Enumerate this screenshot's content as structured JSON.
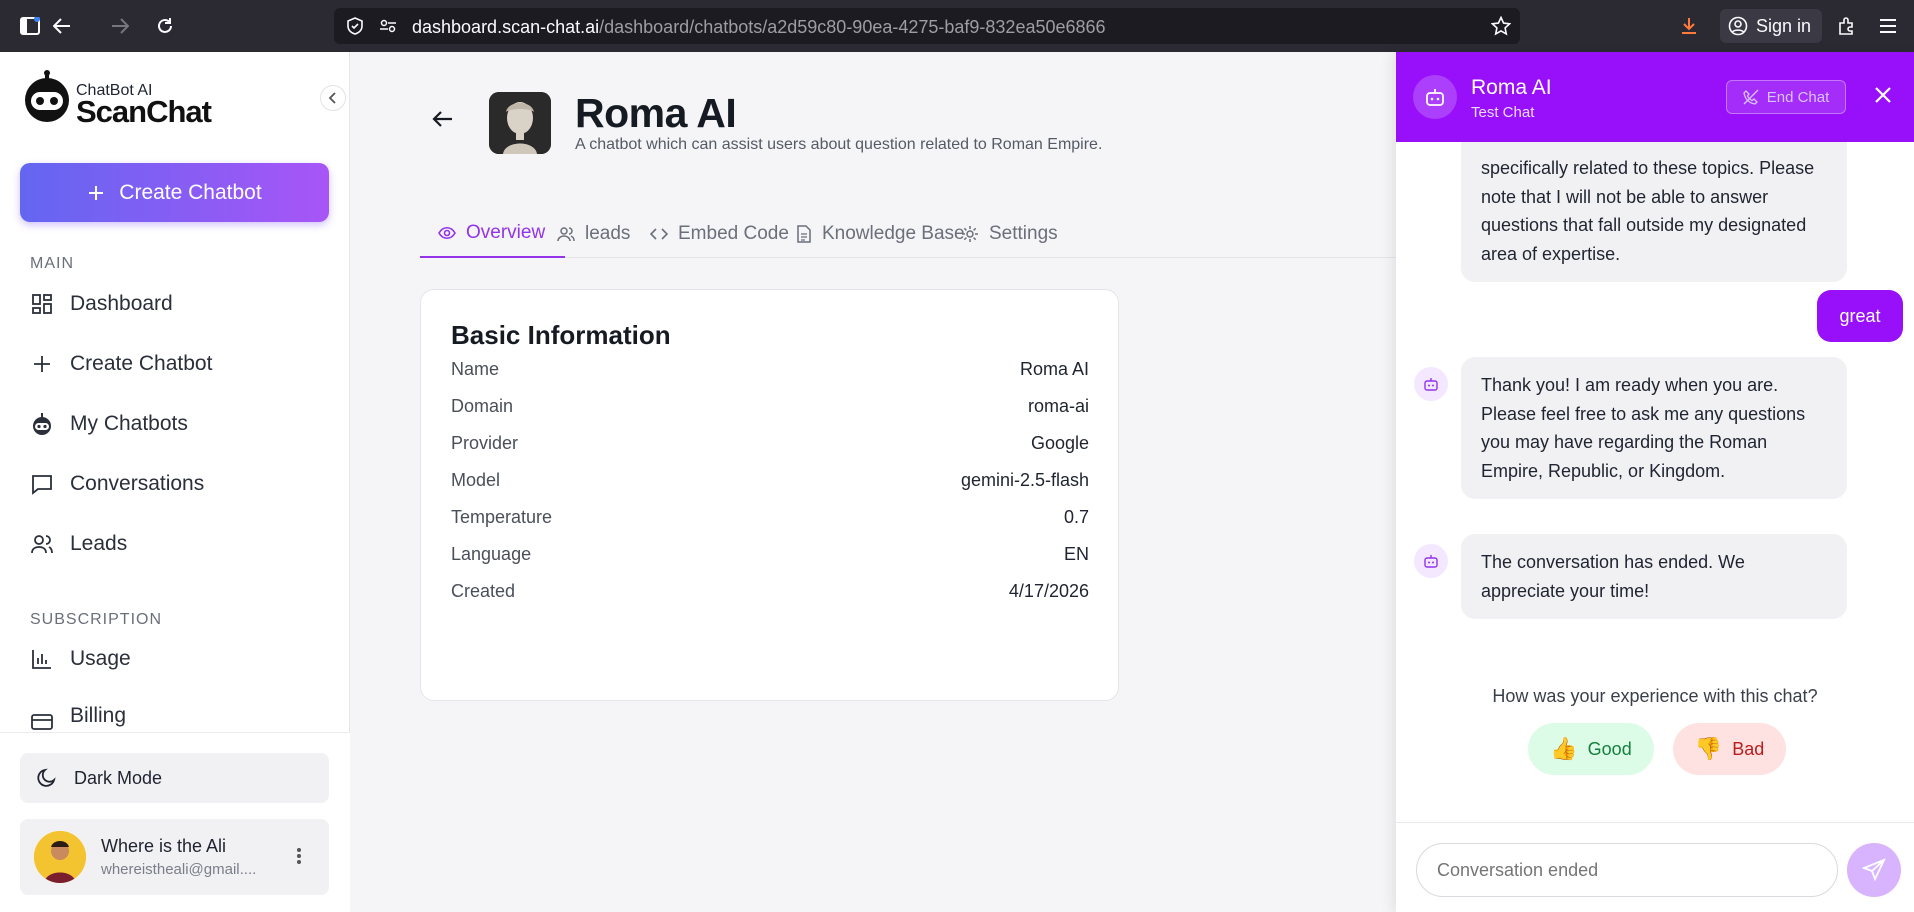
{
  "browser": {
    "url_domain": "dashboard.scan-chat.ai",
    "url_path": "/dashboard/chatbots/a2d59c80-90ea-4275-baf9-832ea50e6866",
    "sign_in": "Sign in"
  },
  "sidebar": {
    "logo_small": "ChatBot AI",
    "logo_big": "ScanChat",
    "create_button": "Create Chatbot",
    "section_main": "MAIN",
    "items": [
      {
        "label": "Dashboard",
        "icon": "dashboard-icon"
      },
      {
        "label": "Create Chatbot",
        "icon": "plus-icon"
      },
      {
        "label": "My Chatbots",
        "icon": "robot-icon"
      },
      {
        "label": "Conversations",
        "icon": "message-icon"
      },
      {
        "label": "Leads",
        "icon": "users-icon"
      }
    ],
    "section_subscription": "SUBSCRIPTION",
    "sub_items": [
      {
        "label": "Usage",
        "icon": "bar-chart-icon"
      },
      {
        "label": "Billing",
        "icon": "credit-card-icon"
      }
    ],
    "dark_mode": "Dark Mode",
    "user": {
      "name": "Where is the Ali",
      "email": "whereistheali@gmail...."
    }
  },
  "main": {
    "title": "Roma AI",
    "subtitle": "A chatbot which can assist users about question related to Roman Empire.",
    "tabs": [
      {
        "label": "Overview",
        "active": true
      },
      {
        "label": "leads"
      },
      {
        "label": "Embed Code"
      },
      {
        "label": "Knowledge Base"
      },
      {
        "label": "Settings"
      }
    ],
    "basic_info": {
      "heading": "Basic Information",
      "rows": [
        {
          "key": "Name",
          "value": "Roma AI"
        },
        {
          "key": "Domain",
          "value": "roma-ai"
        },
        {
          "key": "Provider",
          "value": "Google"
        },
        {
          "key": "Model",
          "value": "gemini-2.5-flash"
        },
        {
          "key": "Temperature",
          "value": "0.7"
        },
        {
          "key": "Language",
          "value": "EN"
        },
        {
          "key": "Created",
          "value": "4/17/2026"
        }
      ]
    }
  },
  "chat": {
    "name": "Roma AI",
    "status": "Test Chat",
    "end_chat": "End Chat",
    "messages": [
      {
        "from": "bot",
        "text": "specifically related to these topics. Please note that I will not be able to answer questions that fall outside my designated area of expertise."
      },
      {
        "from": "user",
        "text": "great"
      },
      {
        "from": "bot",
        "text": "Thank you! I am ready when you are. Please feel free to ask me any questions you may have regarding the Roman Empire, Republic, or Kingdom."
      },
      {
        "from": "bot",
        "text": "The conversation has ended. We appreciate your time!"
      }
    ],
    "feedback_question": "How was your experience with this chat?",
    "good": "Good",
    "bad": "Bad",
    "input_placeholder": "Conversation ended"
  },
  "colors": {
    "accent": "#9810fa",
    "gradient_start": "#6366f1",
    "gradient_end": "#a855f7"
  }
}
